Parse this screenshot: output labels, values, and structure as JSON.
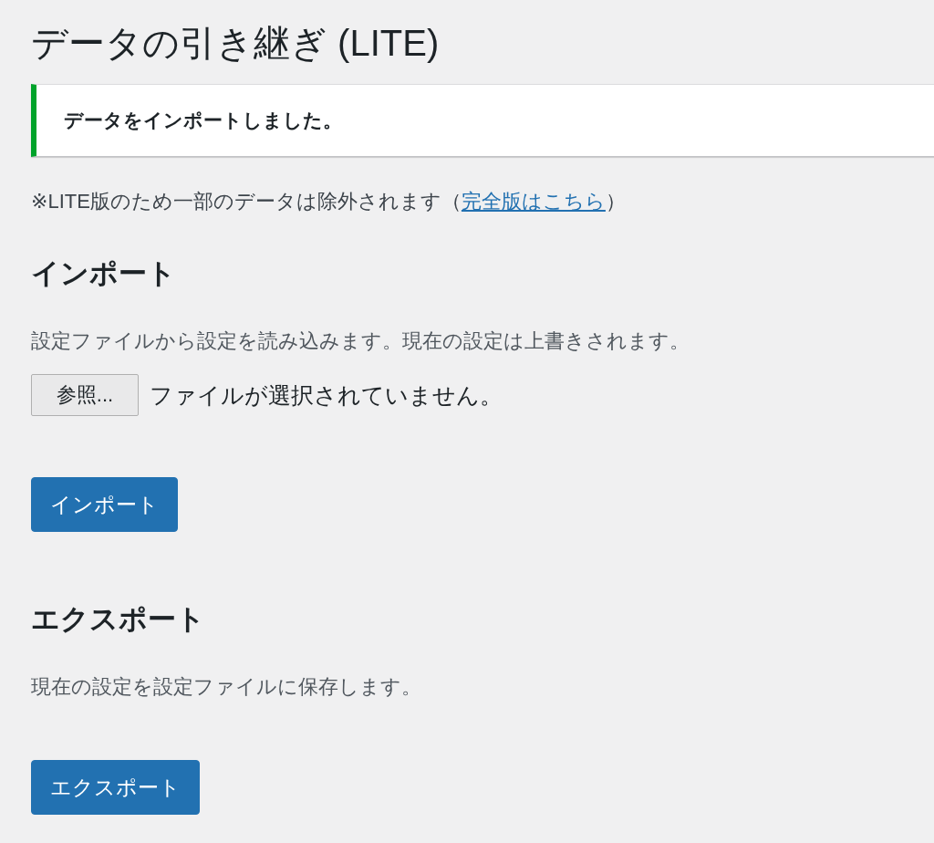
{
  "page": {
    "title": "データの引き継ぎ (LITE)"
  },
  "notice": {
    "message": "データをインポートしました。"
  },
  "note": {
    "text": "※LITE版のため一部のデータは除外されます（",
    "link": "完全版はこちら",
    "suffix": "）"
  },
  "sections": [
    {
      "kind": "import",
      "heading": "インポート",
      "description": "設定ファイルから設定を読み込みます。現在の設定は上書きされます。",
      "file_input": {
        "button": "参照...",
        "status": "ファイルが選択されていません。"
      },
      "button": "インポート"
    },
    {
      "kind": "export",
      "heading": "エクスポート",
      "description": "現在の設定を設定ファイルに保存します。",
      "button": "エクスポート"
    }
  ]
}
